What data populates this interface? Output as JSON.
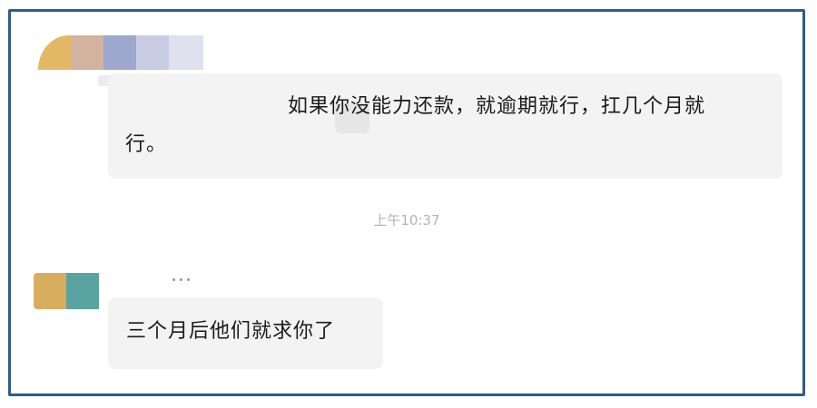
{
  "chat": {
    "messages": [
      {
        "sender": "other",
        "avatar_colors": [
          "#e2b866",
          "#d2b3a0",
          "#9ea8ce",
          "#c8cde4",
          "#dfe1ee"
        ],
        "lines": [
          "如果你没能力还款，就逾期就行，扛几个月就",
          "行。"
        ]
      },
      {
        "sender": "other",
        "avatar_colors": [
          "#d9ad5e",
          "#5aa3a0"
        ],
        "lines": [
          "三个月后他们就求你了"
        ]
      }
    ],
    "timestamp": "上午10:37"
  },
  "colors": {
    "frame_border": "#2e5c86",
    "bubble_bg": "#f3f3f3",
    "timestamp_text": "#b3b3b3"
  }
}
